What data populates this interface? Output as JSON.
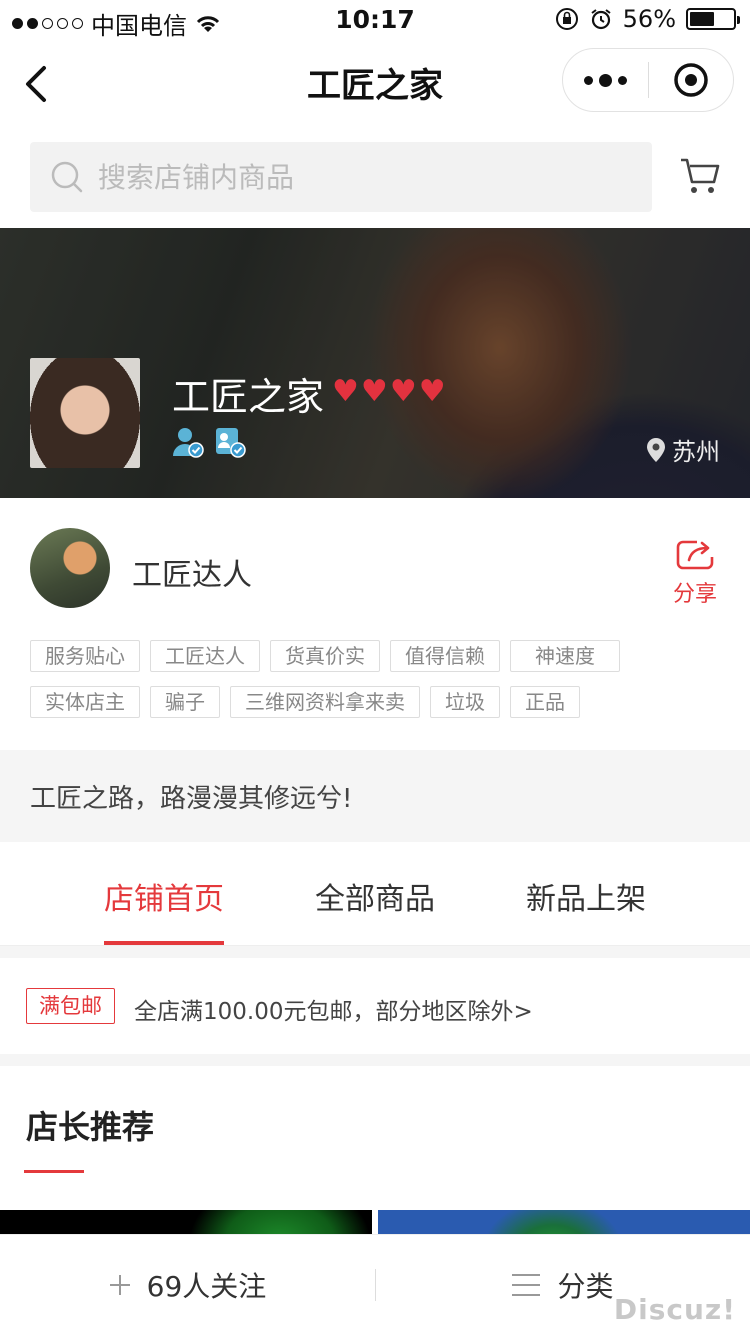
{
  "status_bar": {
    "carrier": "中国电信",
    "time": "10:17",
    "battery": "56%",
    "battery_level": 0.56
  },
  "nav": {
    "title": "工匠之家"
  },
  "search": {
    "placeholder": "搜索店铺内商品"
  },
  "shop": {
    "name": "工匠之家",
    "hearts": [
      "♥",
      "♥",
      "♥",
      "♥"
    ],
    "location": "苏州"
  },
  "owner": {
    "name": "工匠达人",
    "share_label": "分享",
    "tags_row1": [
      "服务贴心",
      "工匠达人",
      "货真价实",
      "值得信赖",
      "神速度"
    ],
    "tags_row2": [
      "实体店主",
      "骗子",
      "三维网资料拿来卖",
      "垃圾",
      "正品"
    ]
  },
  "motto": "工匠之路，路漫漫其修远兮!",
  "tabs": [
    {
      "label": "店铺首页",
      "active": true
    },
    {
      "label": "全部商品",
      "active": false
    },
    {
      "label": "新品上架",
      "active": false
    }
  ],
  "shipping": {
    "badge": "满包邮",
    "text": "全店满100.00元包邮，部分地区除外>"
  },
  "recommend": {
    "title": "店长推荐"
  },
  "bottom": {
    "follow_label": "69人关注",
    "category_label": "分类"
  },
  "watermark": "Discuz!",
  "colors": {
    "accent": "#e4393c"
  }
}
